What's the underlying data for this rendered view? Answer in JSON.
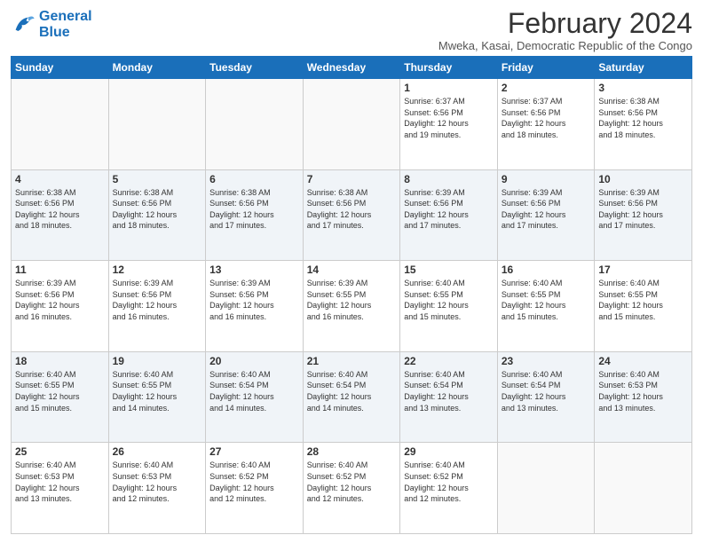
{
  "header": {
    "logo_line1": "General",
    "logo_line2": "Blue",
    "month_year": "February 2024",
    "location": "Mweka, Kasai, Democratic Republic of the Congo"
  },
  "days_of_week": [
    "Sunday",
    "Monday",
    "Tuesday",
    "Wednesday",
    "Thursday",
    "Friday",
    "Saturday"
  ],
  "weeks": [
    [
      {
        "day": "",
        "info": ""
      },
      {
        "day": "",
        "info": ""
      },
      {
        "day": "",
        "info": ""
      },
      {
        "day": "",
        "info": ""
      },
      {
        "day": "1",
        "info": "Sunrise: 6:37 AM\nSunset: 6:56 PM\nDaylight: 12 hours\nand 19 minutes."
      },
      {
        "day": "2",
        "info": "Sunrise: 6:37 AM\nSunset: 6:56 PM\nDaylight: 12 hours\nand 18 minutes."
      },
      {
        "day": "3",
        "info": "Sunrise: 6:38 AM\nSunset: 6:56 PM\nDaylight: 12 hours\nand 18 minutes."
      }
    ],
    [
      {
        "day": "4",
        "info": "Sunrise: 6:38 AM\nSunset: 6:56 PM\nDaylight: 12 hours\nand 18 minutes."
      },
      {
        "day": "5",
        "info": "Sunrise: 6:38 AM\nSunset: 6:56 PM\nDaylight: 12 hours\nand 18 minutes."
      },
      {
        "day": "6",
        "info": "Sunrise: 6:38 AM\nSunset: 6:56 PM\nDaylight: 12 hours\nand 17 minutes."
      },
      {
        "day": "7",
        "info": "Sunrise: 6:38 AM\nSunset: 6:56 PM\nDaylight: 12 hours\nand 17 minutes."
      },
      {
        "day": "8",
        "info": "Sunrise: 6:39 AM\nSunset: 6:56 PM\nDaylight: 12 hours\nand 17 minutes."
      },
      {
        "day": "9",
        "info": "Sunrise: 6:39 AM\nSunset: 6:56 PM\nDaylight: 12 hours\nand 17 minutes."
      },
      {
        "day": "10",
        "info": "Sunrise: 6:39 AM\nSunset: 6:56 PM\nDaylight: 12 hours\nand 17 minutes."
      }
    ],
    [
      {
        "day": "11",
        "info": "Sunrise: 6:39 AM\nSunset: 6:56 PM\nDaylight: 12 hours\nand 16 minutes."
      },
      {
        "day": "12",
        "info": "Sunrise: 6:39 AM\nSunset: 6:56 PM\nDaylight: 12 hours\nand 16 minutes."
      },
      {
        "day": "13",
        "info": "Sunrise: 6:39 AM\nSunset: 6:56 PM\nDaylight: 12 hours\nand 16 minutes."
      },
      {
        "day": "14",
        "info": "Sunrise: 6:39 AM\nSunset: 6:55 PM\nDaylight: 12 hours\nand 16 minutes."
      },
      {
        "day": "15",
        "info": "Sunrise: 6:40 AM\nSunset: 6:55 PM\nDaylight: 12 hours\nand 15 minutes."
      },
      {
        "day": "16",
        "info": "Sunrise: 6:40 AM\nSunset: 6:55 PM\nDaylight: 12 hours\nand 15 minutes."
      },
      {
        "day": "17",
        "info": "Sunrise: 6:40 AM\nSunset: 6:55 PM\nDaylight: 12 hours\nand 15 minutes."
      }
    ],
    [
      {
        "day": "18",
        "info": "Sunrise: 6:40 AM\nSunset: 6:55 PM\nDaylight: 12 hours\nand 15 minutes."
      },
      {
        "day": "19",
        "info": "Sunrise: 6:40 AM\nSunset: 6:55 PM\nDaylight: 12 hours\nand 14 minutes."
      },
      {
        "day": "20",
        "info": "Sunrise: 6:40 AM\nSunset: 6:54 PM\nDaylight: 12 hours\nand 14 minutes."
      },
      {
        "day": "21",
        "info": "Sunrise: 6:40 AM\nSunset: 6:54 PM\nDaylight: 12 hours\nand 14 minutes."
      },
      {
        "day": "22",
        "info": "Sunrise: 6:40 AM\nSunset: 6:54 PM\nDaylight: 12 hours\nand 13 minutes."
      },
      {
        "day": "23",
        "info": "Sunrise: 6:40 AM\nSunset: 6:54 PM\nDaylight: 12 hours\nand 13 minutes."
      },
      {
        "day": "24",
        "info": "Sunrise: 6:40 AM\nSunset: 6:53 PM\nDaylight: 12 hours\nand 13 minutes."
      }
    ],
    [
      {
        "day": "25",
        "info": "Sunrise: 6:40 AM\nSunset: 6:53 PM\nDaylight: 12 hours\nand 13 minutes."
      },
      {
        "day": "26",
        "info": "Sunrise: 6:40 AM\nSunset: 6:53 PM\nDaylight: 12 hours\nand 12 minutes."
      },
      {
        "day": "27",
        "info": "Sunrise: 6:40 AM\nSunset: 6:52 PM\nDaylight: 12 hours\nand 12 minutes."
      },
      {
        "day": "28",
        "info": "Sunrise: 6:40 AM\nSunset: 6:52 PM\nDaylight: 12 hours\nand 12 minutes."
      },
      {
        "day": "29",
        "info": "Sunrise: 6:40 AM\nSunset: 6:52 PM\nDaylight: 12 hours\nand 12 minutes."
      },
      {
        "day": "",
        "info": ""
      },
      {
        "day": "",
        "info": ""
      }
    ]
  ]
}
